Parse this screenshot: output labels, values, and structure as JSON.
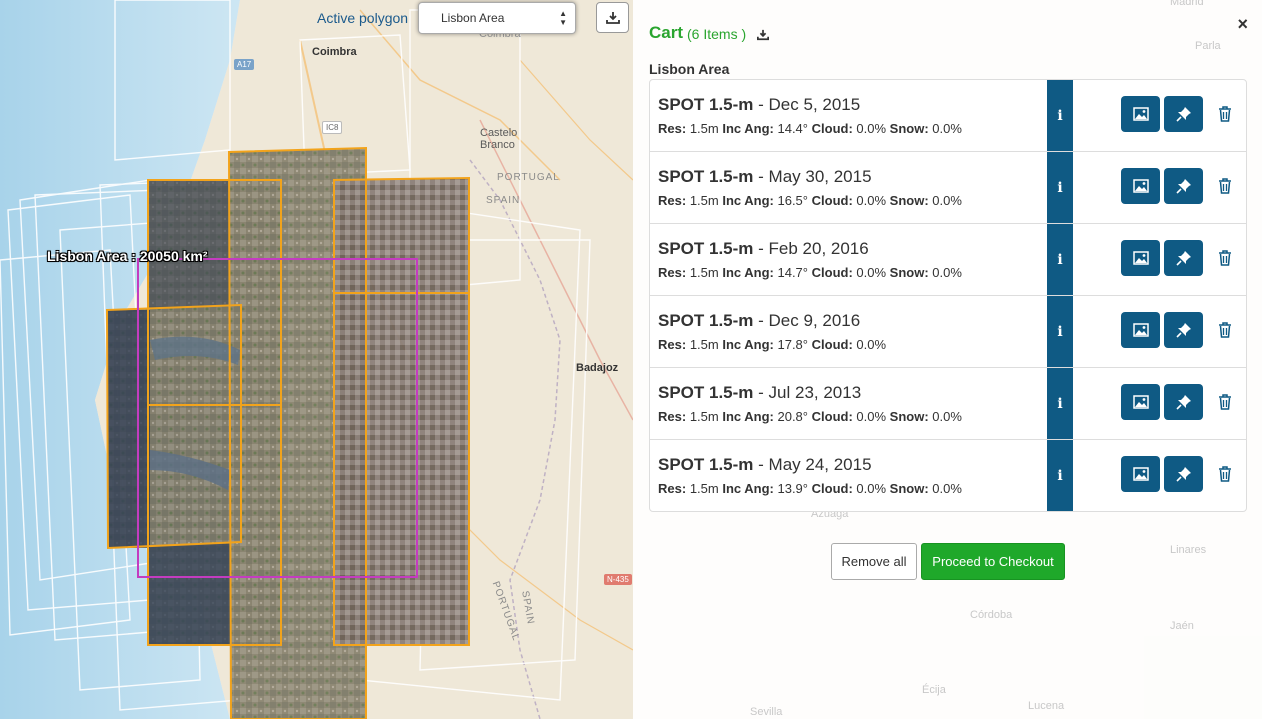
{
  "map": {
    "active_polygon_label": "Active polygon",
    "polygon_select_value": "Lisbon Area",
    "area_label": "Lisbon Area : 20050 km²",
    "places": {
      "coimbra": "Coimbra",
      "castelo_branco_1": "Castelo",
      "castelo_branco_2": "Branco",
      "portugal": "PORTUGAL",
      "spain": "SPAIN",
      "badajoz": "Badajoz",
      "portugal_vertical": "PORTUGAL",
      "spain_vertical": "SPAIN",
      "coimbra_top": "Coimbra"
    },
    "roads": {
      "a17": "A17",
      "ic8": "IC8",
      "n435": "N-435"
    }
  },
  "cart": {
    "title": "Cart",
    "count": "(6 Items )",
    "polygon_name": "Lisbon Area",
    "close": "×",
    "items": [
      {
        "product": "SPOT 1.5-m",
        "date": " - Dec 5, 2015",
        "res_label": "Res:",
        "res": "1.5m",
        "inc_label": "Inc Ang:",
        "inc": "14.4°",
        "cloud_label": "Cloud:",
        "cloud": "0.0%",
        "snow_label": "Snow:",
        "snow": "0.0%"
      },
      {
        "product": "SPOT 1.5-m",
        "date": " - May 30, 2015",
        "res_label": "Res:",
        "res": "1.5m",
        "inc_label": "Inc Ang:",
        "inc": "16.5°",
        "cloud_label": "Cloud:",
        "cloud": "0.0%",
        "snow_label": "Snow:",
        "snow": "0.0%"
      },
      {
        "product": "SPOT 1.5-m",
        "date": " - Feb 20, 2016",
        "res_label": "Res:",
        "res": "1.5m",
        "inc_label": "Inc Ang:",
        "inc": "14.7°",
        "cloud_label": "Cloud:",
        "cloud": "0.0%",
        "snow_label": "Snow:",
        "snow": "0.0%"
      },
      {
        "product": "SPOT 1.5-m",
        "date": " - Dec 9, 2016",
        "res_label": "Res:",
        "res": "1.5m",
        "inc_label": "Inc Ang:",
        "inc": "17.8°",
        "cloud_label": "Cloud:",
        "cloud": "0.0%",
        "snow_label": "",
        "snow": ""
      },
      {
        "product": "SPOT 1.5-m",
        "date": " - Jul 23, 2013",
        "res_label": "Res:",
        "res": "1.5m",
        "inc_label": "Inc Ang:",
        "inc": "20.8°",
        "cloud_label": "Cloud:",
        "cloud": "0.0%",
        "snow_label": "Snow:",
        "snow": "0.0%"
      },
      {
        "product": "SPOT 1.5-m",
        "date": " - May 24, 2015",
        "res_label": "Res:",
        "res": "1.5m",
        "inc_label": "Inc Ang:",
        "inc": "13.9°",
        "cloud_label": "Cloud:",
        "cloud": "0.0%",
        "snow_label": "Snow:",
        "snow": "0.0%"
      }
    ],
    "info_glyph": "i",
    "remove_all": "Remove all",
    "checkout": "Proceed to Checkout"
  },
  "background_places": {
    "madrid": "Madrid",
    "parla": "Parla",
    "linares": "Linares",
    "cordoba": "Córdoba",
    "jaen": "Jaén",
    "ecija": "Écija",
    "lucena": "Lucena",
    "sevilla": "Sevilla",
    "azuaga": "Azuaga"
  },
  "colors": {
    "accent_blue": "#0f5a84",
    "cart_green": "#2aa52f",
    "checkout_green": "#1fa82a",
    "footprint_orange": "#f2a31b",
    "aoi_magenta": "#c43cc0"
  },
  "icons": {
    "download": "download-icon",
    "info": "info-icon",
    "image": "image-icon",
    "pin": "pin-icon",
    "trash": "trash-icon",
    "close": "close-icon",
    "select": "chevron-updown-icon"
  }
}
